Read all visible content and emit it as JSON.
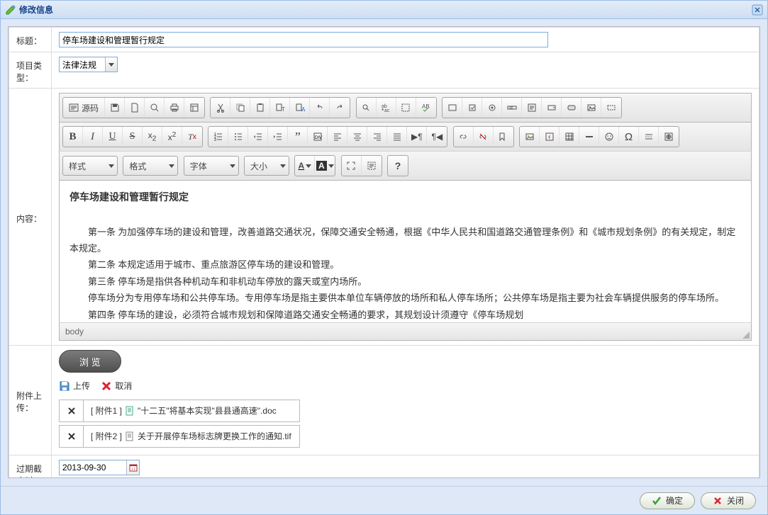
{
  "window": {
    "title": "修改信息"
  },
  "labels": {
    "title": "标题：",
    "project_type": "项目类型：",
    "content": "内容：",
    "attach": "附件上传：",
    "deadline": "过期截止时间："
  },
  "form": {
    "title_value": "停车场建设和管理暂行规定",
    "project_type_value": "法律法规",
    "deadline_value": "2013-09-30"
  },
  "editor": {
    "toolbar": {
      "source": "源码",
      "styles": "样式",
      "format": "格式",
      "font": "字体",
      "size": "大小",
      "help": "?"
    },
    "status_path": "body",
    "content": {
      "heading": "停车场建设和管理暂行规定",
      "p1": "第一条  为加强停车场的建设和管理，改善道路交通状况，保障交通安全畅通，根据《中华人民共和国道路交通管理条例》和《城市规划条例》的有关规定，制定本规定。",
      "p2": "第二条  本规定适用于城市、重点旅游区停车场的建设和管理。",
      "p3": "第三条  停车场是指供各种机动车和非机动车停放的露天或室内场所。",
      "p4": "停车场分为专用停车场和公共停车场。专用停车场是指主要供本单位车辆停放的场所和私人停车场所；公共停车场是指主要为社会车辆提供服务的停车场所。",
      "p5": "第四条  停车场的建设，必须符合城市规划和保障道路交通安全畅通的要求，其规划设计须遵守《停车场规划"
    }
  },
  "attach": {
    "browse": "浏 览",
    "upload": "上传",
    "cancel": "取消",
    "items": [
      {
        "tag": "[ 附件1 ]",
        "name": "\"十二五\"将基本实现\"县县通高速\".doc"
      },
      {
        "tag": "[ 附件2 ]",
        "name": "关于开展停车场标志牌更换工作的通知.tif"
      }
    ]
  },
  "buttons": {
    "ok": "确定",
    "close": "关闭"
  }
}
